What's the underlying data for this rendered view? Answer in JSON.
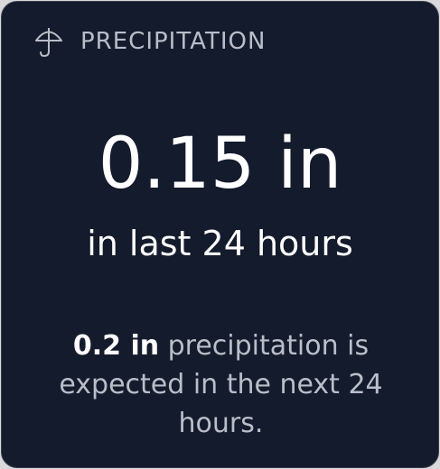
{
  "widget": {
    "icon": "umbrella-icon",
    "title": "PRECIPITATION",
    "value": "0.15 in",
    "period": "in last 24 hours",
    "forecast_amount": "0.2 in",
    "forecast_text_1": " precipitation is expected in the next 24 hours.",
    "colors": {
      "background": "#141b2c",
      "primary_text": "#ffffff",
      "secondary_text": "#b9bec9"
    }
  }
}
